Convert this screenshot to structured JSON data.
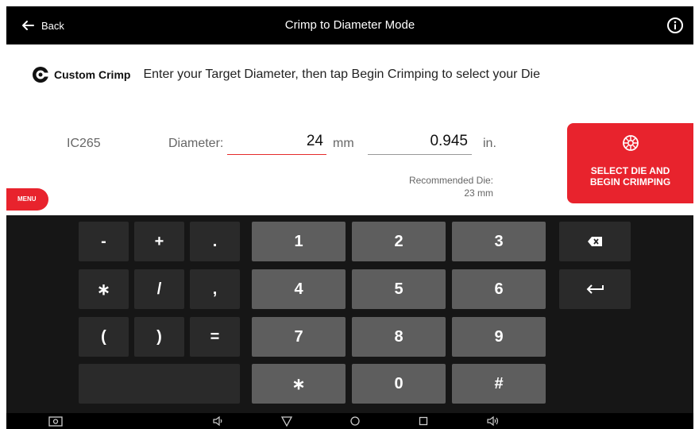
{
  "header": {
    "back_label": "Back",
    "title": "Crimp to Diameter Mode"
  },
  "brand": {
    "name": "Custom Crimp",
    "instruction": "Enter your Target Diameter, then tap Begin Crimping to select your Die"
  },
  "form": {
    "model": "IC265",
    "diameter_label": "Diameter:",
    "mm_value": "24",
    "mm_unit": "mm",
    "in_value": "0.945",
    "in_unit": "in.",
    "recommended_label": "Recommended Die:",
    "recommended_value": "23 mm"
  },
  "actions": {
    "select_die_label": "SELECT DIE AND BEGIN CRIMPING",
    "menu_label": "MENU"
  },
  "keyboard": {
    "minus": "-",
    "plus": "+",
    "dot": ".",
    "star_sym": "∗",
    "slash": "/",
    "comma": ",",
    "lparen": "(",
    "rparen": ")",
    "equals": "=",
    "one": "1",
    "two": "2",
    "three": "3",
    "four": "4",
    "five": "5",
    "six": "6",
    "seven": "7",
    "eight": "8",
    "nine": "9",
    "star": "∗",
    "zero": "0",
    "hash": "#"
  },
  "colors": {
    "accent": "#e8232d",
    "key_num": "#5e5e5e",
    "key_dark": "#2a2a2a",
    "keyboard_bg": "#161616"
  }
}
